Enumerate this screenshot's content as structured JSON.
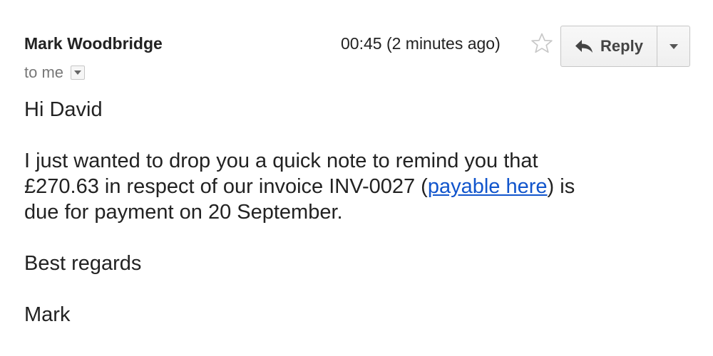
{
  "email": {
    "sender_name": "Mark Woodbridge",
    "recipient_label": "to me",
    "timestamp": "00:45 (2 minutes ago)",
    "reply_label": "Reply"
  },
  "icons": {
    "star": "star-outline-icon",
    "reply": "reply-arrow-icon",
    "more": "chevron-down-icon",
    "recipient_details": "caret-down-icon"
  },
  "body": {
    "greeting": "Hi David",
    "para_part1": "I just wanted to drop you a quick note to remind you that",
    "para_part2": "£270.63 in respect of our invoice INV-0027 (",
    "link_text": "payable here",
    "para_part3": ") is",
    "para_part4": "due for payment on 20 September.",
    "closing": "Best regards",
    "signature": "Mark"
  },
  "colors": {
    "link": "#1155cc",
    "secondary_text": "#777777",
    "button_border": "#c6c6c6"
  }
}
